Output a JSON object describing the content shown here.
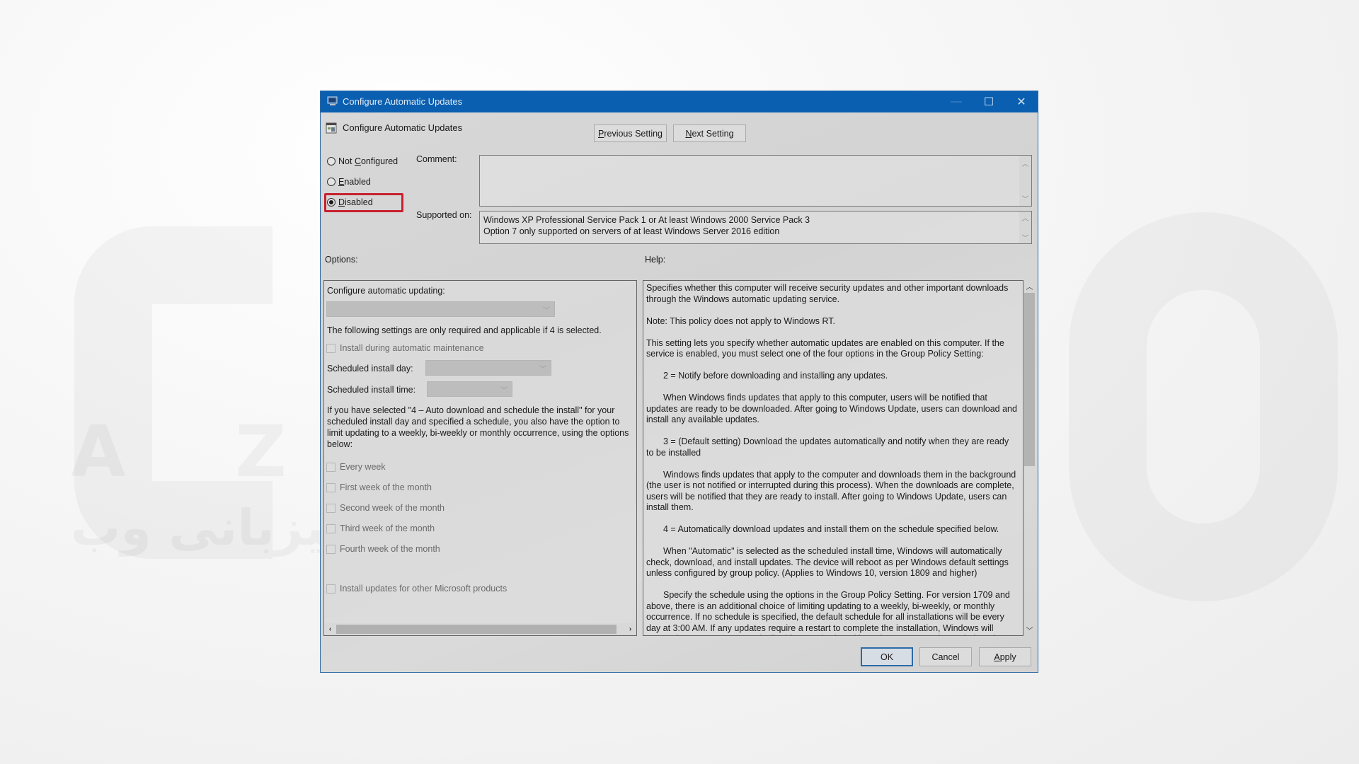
{
  "window": {
    "title": "Configure Automatic Updates",
    "controls": {
      "minimize": "—",
      "maximize": "☐",
      "close": "✕"
    }
  },
  "header": {
    "policy_name": "Configure Automatic Updates",
    "previous_button": {
      "prefix": "",
      "accel": "P",
      "rest": "revious Setting"
    },
    "next_button": {
      "accel": "N",
      "rest": "ext Setting"
    }
  },
  "state": {
    "options": [
      {
        "pre": "Not ",
        "accel": "C",
        "post": "onfigured",
        "selected": false
      },
      {
        "pre": "",
        "accel": "E",
        "post": "nabled",
        "selected": false
      },
      {
        "pre": "",
        "accel": "D",
        "post": "isabled",
        "selected": true
      }
    ],
    "highlight_color": "#c8202f"
  },
  "comment": {
    "label": "Comment:",
    "value": ""
  },
  "supported_on": {
    "label": "Supported on:",
    "lines": [
      "Windows XP Professional Service Pack 1 or At least Windows 2000 Service Pack 3",
      "Option 7 only supported on servers of at least Windows Server 2016 edition"
    ]
  },
  "options_panel": {
    "label": "Options:",
    "configure_label": "Configure automatic updating:",
    "configure_value": "",
    "note": "The following settings are only required and applicable if 4 is selected.",
    "install_maintenance": {
      "label": "Install during automatic maintenance",
      "checked": false
    },
    "install_day": {
      "label": "Scheduled install day:",
      "value": ""
    },
    "install_time": {
      "label": "Scheduled install time:",
      "value": ""
    },
    "schedule_paragraph": "If you have selected \"4 – Auto download and schedule the install\" for your scheduled install day and specified a schedule, you also have the option to limit updating to a weekly, bi-weekly or monthly occurrence, using the options below:",
    "week_options": [
      {
        "label": "Every week",
        "checked": false
      },
      {
        "label": "First week of the month",
        "checked": false
      },
      {
        "label": "Second week of the month",
        "checked": false
      },
      {
        "label": "Third week of the month",
        "checked": false
      },
      {
        "label": "Fourth week of the month",
        "checked": false
      }
    ],
    "other_products": {
      "label": "Install updates for other Microsoft products",
      "checked": false
    }
  },
  "help_panel": {
    "label": "Help:",
    "paragraphs": [
      {
        "text": "Specifies whether this computer will receive security updates and other important downloads through the Windows automatic updating service.",
        "indent": false
      },
      {
        "text": "Note: This policy does not apply to Windows RT.",
        "indent": false
      },
      {
        "text": "This setting lets you specify whether automatic updates are enabled on this computer. If the service is enabled, you must select one of the four options in the Group Policy Setting:",
        "indent": false
      },
      {
        "text": "2 = Notify before downloading and installing any updates.",
        "indent": true
      },
      {
        "text": "When Windows finds updates that apply to this computer, users will be notified that updates are ready to be downloaded. After going to Windows Update, users can download and install any available updates.",
        "indent": true
      },
      {
        "text": "3 = (Default setting) Download the updates automatically and notify when they are ready to be installed",
        "indent": true
      },
      {
        "text": "Windows finds updates that apply to the computer and downloads them in the background (the user is not notified or interrupted during this process). When the downloads are complete, users will be notified that they are ready to install. After going to Windows Update, users can install them.",
        "indent": true
      },
      {
        "text": "4 = Automatically download updates and install them on the schedule specified below.",
        "indent": true
      },
      {
        "text": "When \"Automatic\" is selected as the scheduled install time, Windows will automatically check, download, and install updates. The device will reboot as per Windows default settings unless configured by group policy. (Applies to Windows 10, version 1809 and higher)",
        "indent": true
      },
      {
        "text": "Specify the schedule using the options in the Group Policy Setting. For version 1709 and above, there is an additional choice of limiting updating to a weekly, bi-weekly, or monthly occurrence. If no schedule is specified, the default schedule for all installations will be every day at 3:00 AM. If any updates require a restart to complete the installation, Windows will restart the computer automatically. (If a user is signed in to the computer when Windows is ready to restart, the user will be notified and given the option to delay the restart.)",
        "indent": true
      }
    ],
    "scroll_position": 0
  },
  "footer": {
    "ok": "OK",
    "cancel": "Cancel",
    "apply": {
      "accel": "A",
      "rest": "pply"
    }
  },
  "watermark": {
    "latin": "A  Z  A  R",
    "arabic": "میزبانی وب"
  }
}
